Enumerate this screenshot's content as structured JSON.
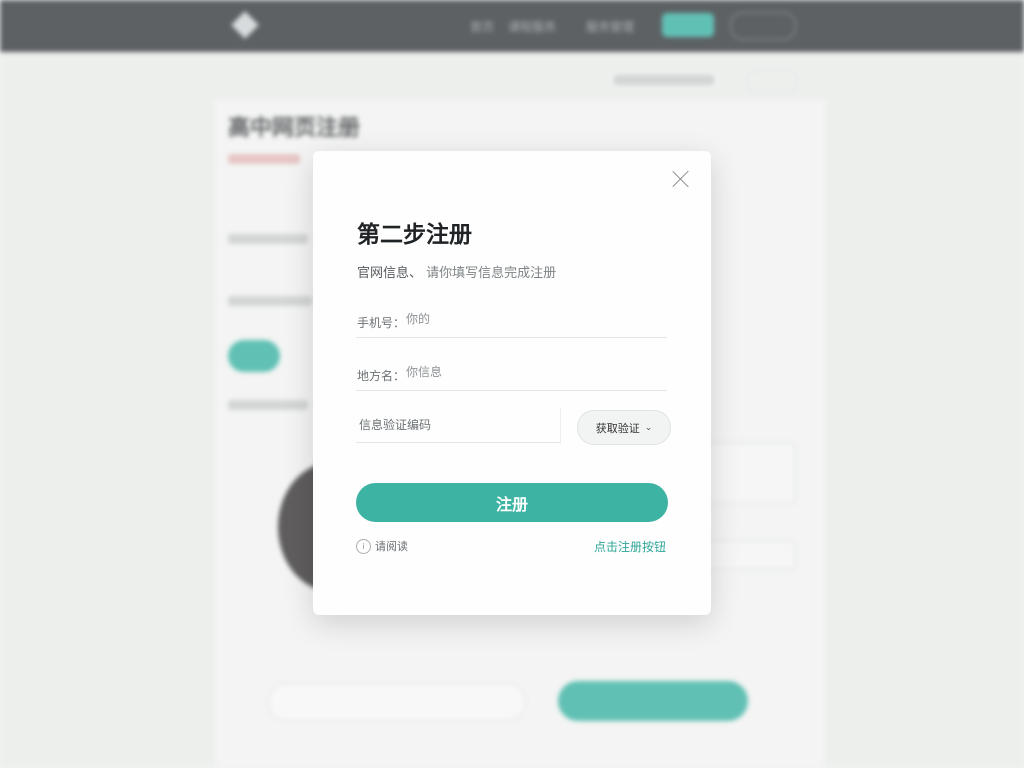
{
  "background": {
    "nav_items": [
      "首页",
      "课程服务",
      "服务管理"
    ],
    "page_title": "高中网页注册"
  },
  "modal": {
    "title": "第二步注册",
    "description_main": "官网信息、",
    "description_muted": "请你填写信息完成注册",
    "fields": [
      {
        "label": "手机号：",
        "placeholder": "你的"
      },
      {
        "label": "地方名：",
        "placeholder": "你信息"
      }
    ],
    "code_placeholder": "信息验证编码",
    "code_button": "获取验证",
    "code_button_icon": "chevron-down",
    "submit_label": "注册",
    "agreement_label": "请阅读",
    "agreement_icon": "info",
    "link_label": "点击注册按钮",
    "close_icon": "close",
    "accent_color": "#3db3a3"
  }
}
